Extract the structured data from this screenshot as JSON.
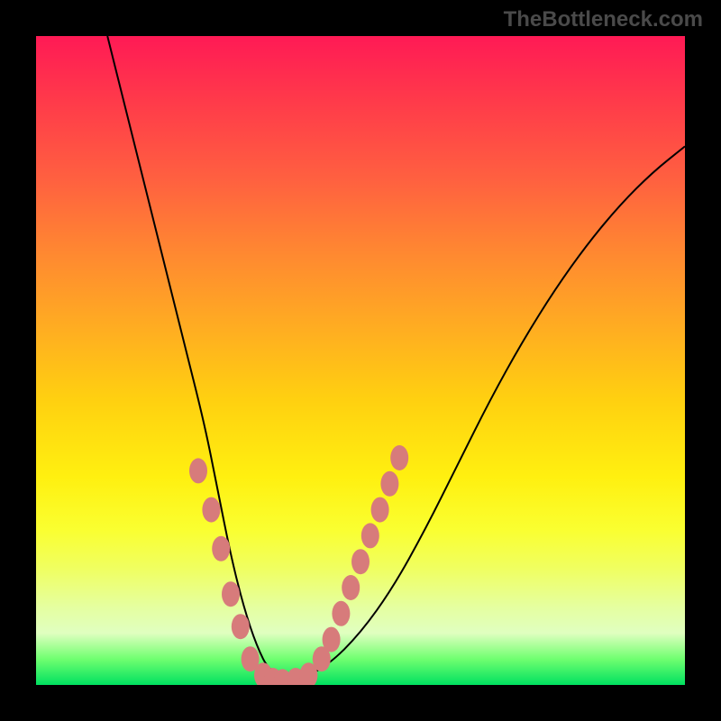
{
  "watermark": "TheBottleneck.com",
  "chart_data": {
    "type": "line",
    "title": "",
    "xlabel": "",
    "ylabel": "",
    "xlim": [
      0,
      100
    ],
    "ylim": [
      0,
      100
    ],
    "series": [
      {
        "name": "bottleneck-curve",
        "x": [
          11,
          14,
          17,
          20,
          23,
          26,
          28,
          30,
          32,
          34,
          36,
          40,
          45,
          50,
          55,
          60,
          65,
          70,
          75,
          80,
          85,
          90,
          95,
          100
        ],
        "y": [
          100,
          88,
          76,
          64,
          52,
          40,
          30,
          20,
          12,
          6,
          2,
          0.5,
          3,
          8,
          15,
          24,
          34,
          44,
          53,
          61,
          68,
          74,
          79,
          83
        ]
      }
    ],
    "markers": {
      "name": "highlighted-points",
      "points": [
        {
          "x": 25,
          "y": 33
        },
        {
          "x": 27,
          "y": 27
        },
        {
          "x": 28.5,
          "y": 21
        },
        {
          "x": 30,
          "y": 14
        },
        {
          "x": 31.5,
          "y": 9
        },
        {
          "x": 33,
          "y": 4
        },
        {
          "x": 35,
          "y": 1.5
        },
        {
          "x": 36.5,
          "y": 0.7
        },
        {
          "x": 38,
          "y": 0.5
        },
        {
          "x": 40,
          "y": 0.7
        },
        {
          "x": 42,
          "y": 1.5
        },
        {
          "x": 44,
          "y": 4
        },
        {
          "x": 45.5,
          "y": 7
        },
        {
          "x": 47,
          "y": 11
        },
        {
          "x": 48.5,
          "y": 15
        },
        {
          "x": 50,
          "y": 19
        },
        {
          "x": 51.5,
          "y": 23
        },
        {
          "x": 53,
          "y": 27
        },
        {
          "x": 54.5,
          "y": 31
        },
        {
          "x": 56,
          "y": 35
        }
      ]
    },
    "background_gradient": {
      "top": "#ff1a55",
      "bottom": "#00e060"
    }
  }
}
